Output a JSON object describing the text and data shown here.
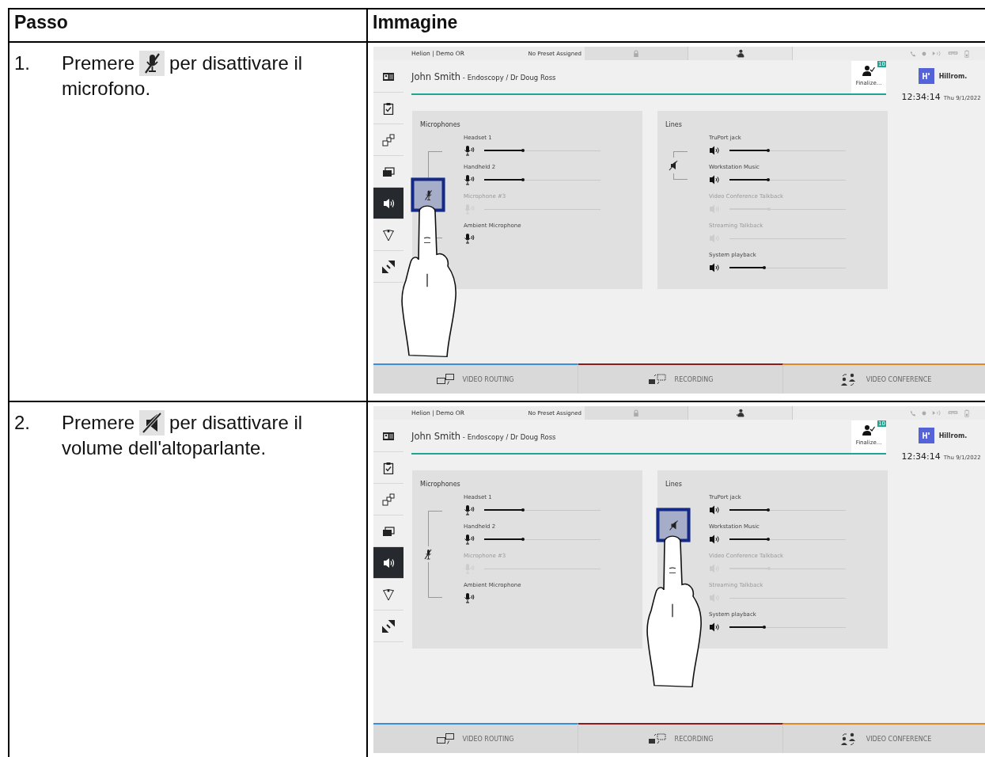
{
  "table": {
    "columns": [
      "Passo",
      "Immagine"
    ],
    "rows": [
      {
        "step": "1.",
        "text_before": "Premere",
        "kind": "microphone",
        "text_after": "per disattivare il",
        "continuation": "microfono.",
        "screenshot": {
          "top_bar": {
            "room": "Helion | Demo OR",
            "preset": "No Preset Assigned"
          },
          "sidebar": [
            {
              "kind": "patient-card",
              "selected": false
            },
            {
              "kind": "checklist",
              "selected": false
            },
            {
              "kind": "layout",
              "selected": false
            },
            {
              "kind": "display",
              "selected": false
            },
            {
              "kind": "audio",
              "selected": true
            },
            {
              "kind": "lighting",
              "selected": false
            },
            {
              "kind": "camera",
              "selected": false
            }
          ],
          "patient": {
            "name": "John Smith",
            "detail": "- Endoscopy / Dr Doug Ross"
          },
          "finalize": {
            "badge": "10",
            "label": "Finalize..."
          },
          "brand": "Hillrom.",
          "clock": {
            "time": "12:34:14",
            "date": "Thu 9/1/2022"
          },
          "panels": [
            {
              "kind": "microphones",
              "title": "Microphones",
              "mute_highlighted": true,
              "items": [
                {
                  "name": "Headset 1",
                  "disabled": false,
                  "in_group": true,
                  "slider": true,
                  "level": 0.33
                },
                {
                  "name": "Handheld 2",
                  "disabled": false,
                  "in_group": true,
                  "slider": true,
                  "level": 0.33
                },
                {
                  "name": "Microphone #3",
                  "disabled": true,
                  "in_group": true,
                  "slider": true
                },
                {
                  "name": "Ambient Microphone",
                  "disabled": false,
                  "in_group": true,
                  "slider": false
                }
              ]
            },
            {
              "kind": "lines",
              "title": "Lines",
              "mute_highlighted": false,
              "items": [
                {
                  "name": "TruPort jack",
                  "disabled": false,
                  "in_group": true,
                  "slider": true,
                  "level": 0.33
                },
                {
                  "name": "Workstation Music",
                  "disabled": false,
                  "in_group": true,
                  "slider": true,
                  "level": 0.33
                },
                {
                  "name": "Video Conference Talkback",
                  "disabled": true,
                  "in_group": false,
                  "slider": true,
                  "level": 0.34
                },
                {
                  "name": "Streaming Talkback",
                  "disabled": true,
                  "in_group": false,
                  "slider": true
                },
                {
                  "name": "System playback",
                  "disabled": false,
                  "in_group": false,
                  "slider": true,
                  "level": 0.3
                }
              ]
            }
          ],
          "tabs": [
            {
              "kind": "video-routing",
              "label": "VIDEO ROUTING",
              "color": "#3b8fd9"
            },
            {
              "kind": "recording",
              "label": "RECORDING",
              "color": "#8c1c1c"
            },
            {
              "kind": "video-conference",
              "label": "VIDEO CONFERENCE",
              "color": "#e0892b"
            }
          ]
        }
      },
      {
        "step": "2.",
        "text_before": "Premere",
        "kind": "speaker",
        "text_after": "per disattivare il",
        "continuation": "volume dell'altoparlante.",
        "screenshot": {
          "top_bar": {
            "room": "Helion | Demo OR",
            "preset": "No Preset Assigned"
          },
          "sidebar": [
            {
              "kind": "patient-card",
              "selected": false
            },
            {
              "kind": "checklist",
              "selected": false
            },
            {
              "kind": "layout",
              "selected": false
            },
            {
              "kind": "display",
              "selected": false
            },
            {
              "kind": "audio",
              "selected": true
            },
            {
              "kind": "lighting",
              "selected": false
            },
            {
              "kind": "camera",
              "selected": false
            }
          ],
          "patient": {
            "name": "John Smith",
            "detail": "- Endoscopy / Dr Doug Ross"
          },
          "finalize": {
            "badge": "10",
            "label": "Finalize..."
          },
          "brand": "Hillrom.",
          "clock": {
            "time": "12:34:14",
            "date": "Thu 9/1/2022"
          },
          "panels": [
            {
              "kind": "microphones",
              "title": "Microphones",
              "mute_highlighted": false,
              "items": [
                {
                  "name": "Headset 1",
                  "disabled": false,
                  "in_group": true,
                  "slider": true,
                  "level": 0.33
                },
                {
                  "name": "Handheld 2",
                  "disabled": false,
                  "in_group": true,
                  "slider": true,
                  "level": 0.33
                },
                {
                  "name": "Microphone #3",
                  "disabled": true,
                  "in_group": true,
                  "slider": true
                },
                {
                  "name": "Ambient Microphone",
                  "disabled": false,
                  "in_group": true,
                  "slider": false
                }
              ]
            },
            {
              "kind": "lines",
              "title": "Lines",
              "mute_highlighted": true,
              "items": [
                {
                  "name": "TruPort jack",
                  "disabled": false,
                  "in_group": true,
                  "slider": true,
                  "level": 0.33
                },
                {
                  "name": "Workstation Music",
                  "disabled": false,
                  "in_group": true,
                  "slider": true,
                  "level": 0.33
                },
                {
                  "name": "Video Conference Talkback",
                  "disabled": true,
                  "in_group": false,
                  "slider": true,
                  "level": 0.34
                },
                {
                  "name": "Streaming Talkback",
                  "disabled": true,
                  "in_group": false,
                  "slider": true
                },
                {
                  "name": "System playback",
                  "disabled": false,
                  "in_group": false,
                  "slider": true,
                  "level": 0.3
                }
              ]
            }
          ],
          "tabs": [
            {
              "kind": "video-routing",
              "label": "VIDEO ROUTING",
              "color": "#3b8fd9"
            },
            {
              "kind": "recording",
              "label": "RECORDING",
              "color": "#8c1c1c"
            },
            {
              "kind": "video-conference",
              "label": "VIDEO CONFERENCE",
              "color": "#e0892b"
            }
          ]
        }
      }
    ]
  }
}
